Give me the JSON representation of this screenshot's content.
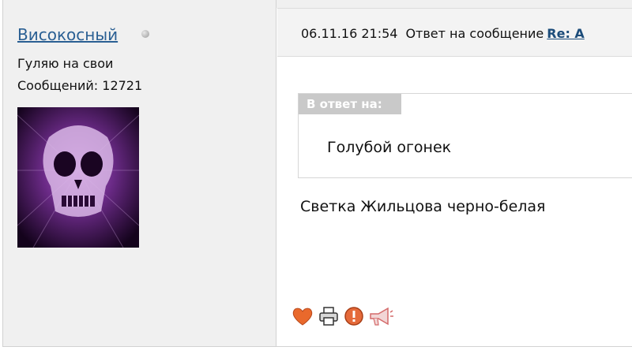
{
  "user": {
    "name": "Високосный",
    "title": "Гуляю на свои",
    "posts": "Сообщений: 12721"
  },
  "header": {
    "date": "06.11.16 21:54",
    "reply_label": "Ответ на сообщение",
    "reply_link": "Re: А"
  },
  "quote": {
    "heading": "В ответ на:",
    "text": "Голубой огонек"
  },
  "message": {
    "text": "Светка Жильцова черно-белая"
  },
  "actions": [
    {
      "icon": "heart-icon"
    },
    {
      "icon": "printer-icon"
    },
    {
      "icon": "alert-icon"
    },
    {
      "icon": "megaphone-icon"
    }
  ],
  "colors": {
    "sidebar_bg": "#f0f0f0",
    "link": "#2a5f93",
    "quote_header": "#c9c9c9"
  }
}
